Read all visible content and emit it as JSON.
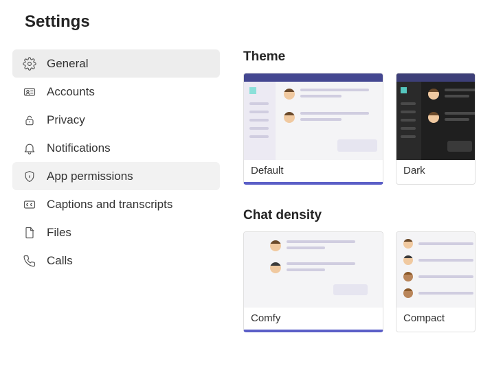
{
  "page_title": "Settings",
  "sidebar": {
    "items": [
      {
        "icon": "gear-icon",
        "label": "General"
      },
      {
        "icon": "id-card-icon",
        "label": "Accounts"
      },
      {
        "icon": "lock-icon",
        "label": "Privacy"
      },
      {
        "icon": "bell-icon",
        "label": "Notifications"
      },
      {
        "icon": "shield-icon",
        "label": "App permissions"
      },
      {
        "icon": "cc-icon",
        "label": "Captions and transcripts"
      },
      {
        "icon": "file-icon",
        "label": "Files"
      },
      {
        "icon": "phone-icon",
        "label": "Calls"
      }
    ],
    "active_index": 0,
    "hover_index": 4
  },
  "sections": {
    "theme": {
      "title": "Theme",
      "options": [
        {
          "label": "Default",
          "selected": true
        },
        {
          "label": "Dark",
          "selected": false
        }
      ]
    },
    "chat_density": {
      "title": "Chat density",
      "options": [
        {
          "label": "Comfy",
          "selected": true
        },
        {
          "label": "Compact",
          "selected": false
        }
      ]
    }
  },
  "colors": {
    "accent": "#5b5fc7",
    "nav_active_bg": "#ededed"
  }
}
